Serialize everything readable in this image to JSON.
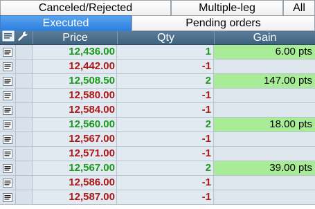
{
  "tabs_top": [
    {
      "label": "Canceled/Rejected"
    },
    {
      "label": "Multiple-leg"
    },
    {
      "label": "All"
    }
  ],
  "tabs_second": [
    {
      "label": "Executed",
      "active": true
    },
    {
      "label": "Pending orders",
      "active": false
    }
  ],
  "columns": {
    "price": "Price",
    "qty": "Qty",
    "gain": "Gain"
  },
  "colors": {
    "buy": "#1a9a1a",
    "sell": "#b01818",
    "gain_bg": "#a8ec98",
    "header_bg": "#4a6d8a",
    "active_tab": "#3a8ce6"
  },
  "rows": [
    {
      "price": "12,436.00",
      "qty": "1",
      "gain": "6.00 pts",
      "side": "buy"
    },
    {
      "price": "12,442.00",
      "qty": "-1",
      "gain": "",
      "side": "sell"
    },
    {
      "price": "12,508.50",
      "qty": "2",
      "gain": "147.00 pts",
      "side": "buy"
    },
    {
      "price": "12,580.00",
      "qty": "-1",
      "gain": "",
      "side": "sell"
    },
    {
      "price": "12,584.00",
      "qty": "-1",
      "gain": "",
      "side": "sell"
    },
    {
      "price": "12,560.00",
      "qty": "2",
      "gain": "18.00 pts",
      "side": "buy"
    },
    {
      "price": "12,567.00",
      "qty": "-1",
      "gain": "",
      "side": "sell"
    },
    {
      "price": "12,571.00",
      "qty": "-1",
      "gain": "",
      "side": "sell"
    },
    {
      "price": "12,567.00",
      "qty": "2",
      "gain": "39.00 pts",
      "side": "buy"
    },
    {
      "price": "12,586.00",
      "qty": "-1",
      "gain": "",
      "side": "sell"
    },
    {
      "price": "12,587.00",
      "qty": "-1",
      "gain": "",
      "side": "sell"
    }
  ]
}
